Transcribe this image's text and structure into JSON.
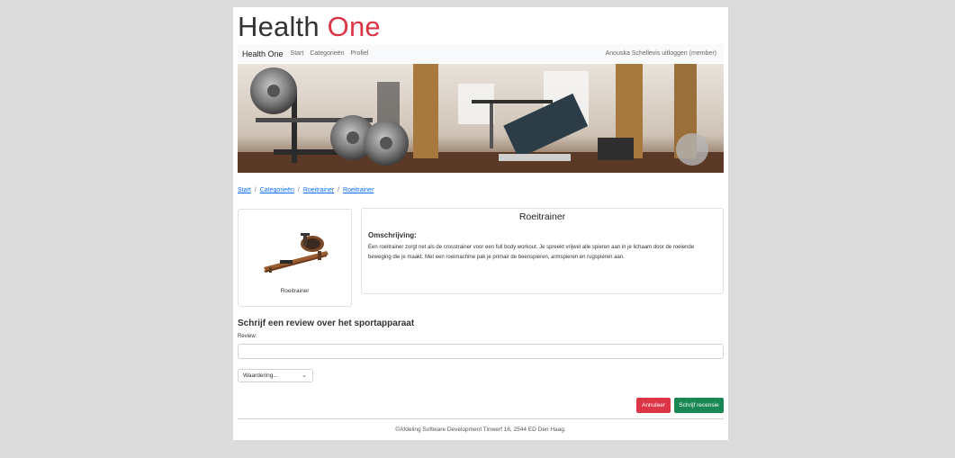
{
  "logo": {
    "part1": "Health ",
    "part2": "One"
  },
  "navbar": {
    "brand": "Health One",
    "links": [
      "Start",
      "Categorieën",
      "Profiel"
    ],
    "user_text": "Anouska Schellevis",
    "logout_text": "uitloggen",
    "role_text": "(member)"
  },
  "breadcrumb": [
    "Start",
    "Categorieën",
    "Roeitrainer",
    "Roeitrainer"
  ],
  "product": {
    "caption": "Roeitrainer",
    "title": "Roeitrainer",
    "description_heading": "Omschrijving:",
    "description": "Een roeitrainer zorgt net als de crosstrainer voor een full body workout. Je spreekt vrijwel alle spieren aan in je lichaam door de roeiende beweging die je maakt. Met een roeimachine pak je primair de beenspieren, armspieren en rugspieren aan."
  },
  "review": {
    "heading": "Schrijf een review over het sportapparaat",
    "label": "Review:",
    "value": "",
    "rating_selected": "Waardering..."
  },
  "buttons": {
    "cancel": "Annuleer",
    "submit": "Schrijf recensie"
  },
  "footer": "©Afdeling Software Development Tinwerf 16, 2544 ED Den Haag.",
  "colors": {
    "accent_red": "#dc3545",
    "success_green": "#198754",
    "link_blue": "#0d6efd"
  }
}
